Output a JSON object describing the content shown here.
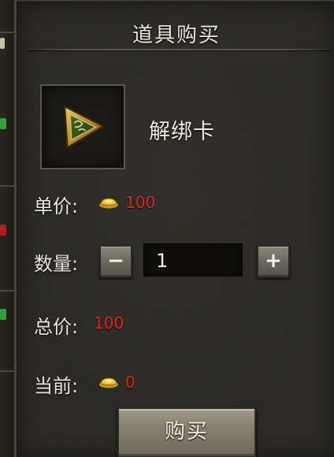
{
  "dialog": {
    "title": "道具购买"
  },
  "item": {
    "name": "解绑卡",
    "icon": "triangle-card-icon"
  },
  "price": {
    "label": "单价:",
    "currency_icon": "gold-ingot-icon",
    "value": "100"
  },
  "quantity": {
    "label": "数量:",
    "decrement_label": "−",
    "increment_label": "+",
    "value": "1"
  },
  "total": {
    "label": "总价:",
    "value": "100"
  },
  "current": {
    "label": "当前:",
    "currency_icon": "gold-ingot-icon",
    "value": "0"
  },
  "actions": {
    "buy_label": "购买"
  },
  "colors": {
    "panel_bg": "#2a2925",
    "text": "#ebe7dc",
    "value_red": "#e0261c",
    "ingot_gold": "#f2c230"
  }
}
